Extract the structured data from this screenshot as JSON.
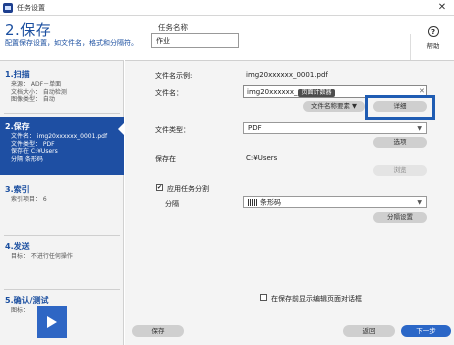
{
  "window": {
    "title": "任务设置",
    "close_label": "✕"
  },
  "header": {
    "step_title": "2.保存",
    "step_desc": "配置保存设置，如文件名，格式和分隔符。",
    "job_name_label": "任务名称",
    "job_name_value": "作业",
    "help_icon": "?",
    "help_label": "帮助"
  },
  "sidebar": {
    "steps": [
      {
        "title": "1.扫描",
        "detail": "来源： ADF－单面\n文档大小： 自动检测\n图像类型： 自动"
      },
      {
        "title": "2.保存",
        "detail": "文件名： img20xxxxxx_0001.pdf\n文件类型： PDF\n保存在 C:¥Users\n分隔 条形码"
      },
      {
        "title": "3.索引",
        "detail": "索引项目： 6"
      },
      {
        "title": "4.发送",
        "detail": "目标： 不进行任何操作"
      },
      {
        "title": "5.确认/测试",
        "detail": "图标："
      }
    ]
  },
  "main": {
    "filename_example_label": "文件名示例:",
    "filename_example_value": "img20xxxxxx_0001.pdf",
    "filename_label": "文件名：",
    "filename_prefix": "img20xxxxxx_",
    "filename_token": "页面计数器",
    "filename_clear": "✕",
    "filename_elements_button": "文件名称要素 ▼",
    "detail_button": "详细",
    "file_type_label": "文件类型：",
    "file_type_value": "PDF",
    "options_button": "选项",
    "save_in_label": "保存在",
    "save_in_value": "C:¥Users",
    "browse_button": "浏览",
    "apply_separation_label": "应用任务分割",
    "apply_separation_checked": "✔",
    "separation_label": "分隔",
    "separation_value": "条形码",
    "separation_settings_button": "分隔设置",
    "show_edit_dialog_label": "在保存前显示编辑页面对话框",
    "save_button": "保存",
    "back_button": "返回",
    "next_button": "下一步"
  },
  "colors": {
    "accent": "#1e4fa3",
    "highlight": "#1f5cb3"
  }
}
